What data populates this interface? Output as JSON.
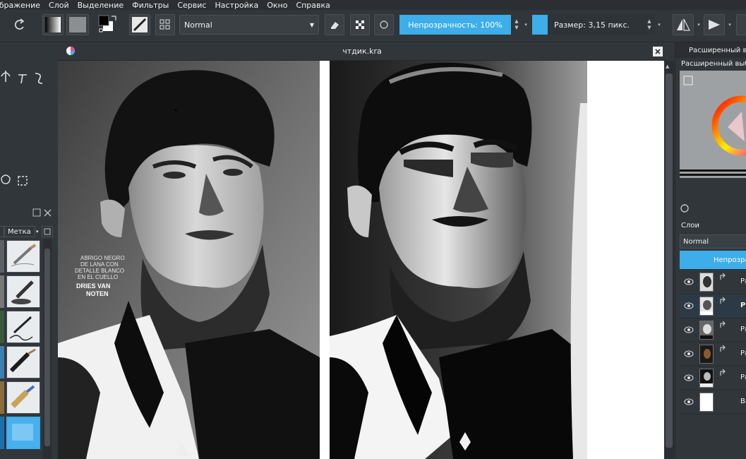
{
  "menu": [
    "ображение",
    "Слой",
    "Выделение",
    "Фильтры",
    "Сервис",
    "Настройка",
    "Окно",
    "Справка"
  ],
  "toolbar": {
    "blend_mode": "Normal",
    "opacity_label": "Непрозрачность: 100%",
    "size_label": "Размер: 3,15 пикс."
  },
  "brush_presets": {
    "tag_label": "Метка"
  },
  "document": {
    "title": "чтдик.kra"
  },
  "magazine_text": {
    "line1": "ABRIGO NEGRO",
    "line2": "DE LANA CON",
    "line3": "DETALLE BLANCO",
    "line4": "EN EL CUELLO",
    "brand1": "DRIES VAN",
    "brand2": "NOTEN"
  },
  "right_dock": {
    "tab_title": "Расширенный выбо",
    "selector_title": "Расширенный выбор",
    "layers_label": "Слои",
    "layers_blend": "Normal",
    "layers_opacity": "Непрозрачн",
    "layers": [
      {
        "name": "Ра",
        "active": false,
        "thumb": "portrait-bw"
      },
      {
        "name": "Р",
        "active": true,
        "thumb": "portrait-light"
      },
      {
        "name": "Ра",
        "active": false,
        "thumb": "portrait-dark"
      },
      {
        "name": "Ра",
        "active": false,
        "thumb": "portrait-brown"
      },
      {
        "name": "Ра",
        "active": false,
        "thumb": "portrait-black"
      },
      {
        "name": "Ва",
        "active": false,
        "thumb": "white"
      }
    ]
  },
  "colors": {
    "accent": "#3daee9",
    "panel": "#31363b",
    "menubar": "#2b2f33"
  }
}
